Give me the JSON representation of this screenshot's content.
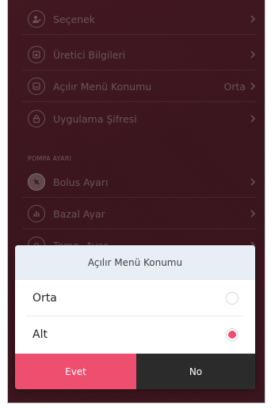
{
  "menu": {
    "items": [
      {
        "label": "Seçenek",
        "value": "",
        "icon": "person-settings-icon"
      },
      {
        "label": "Üretici Bilgileri",
        "value": "",
        "icon": "info-card-icon"
      },
      {
        "label": "Açılır Menü Konumu",
        "value": "Orta",
        "icon": "popup-position-icon"
      },
      {
        "label": "Uygulama Şifresi",
        "value": "",
        "icon": "lock-icon"
      }
    ],
    "section_title": "POMPA AYARI",
    "section_items": [
      {
        "label": "Bolus Ayarı",
        "value": "",
        "icon": "syringe-icon"
      },
      {
        "label": "Bazal Ayar",
        "value": "",
        "icon": "bar-chart-icon"
      },
      {
        "label": "Temp. Ayar",
        "value": "",
        "icon": "temp-icon"
      }
    ]
  },
  "dialog": {
    "title": "Açılır Menü Konumu",
    "options": [
      {
        "label": "Orta",
        "selected": false
      },
      {
        "label": "Alt",
        "selected": true
      }
    ],
    "confirm_label": "Evet",
    "cancel_label": "No"
  },
  "colors": {
    "accent": "#ef4f6f",
    "background": "#5a1f2d",
    "dialog_header": "#e7eef5",
    "cancel_button": "#2b2b2b"
  }
}
